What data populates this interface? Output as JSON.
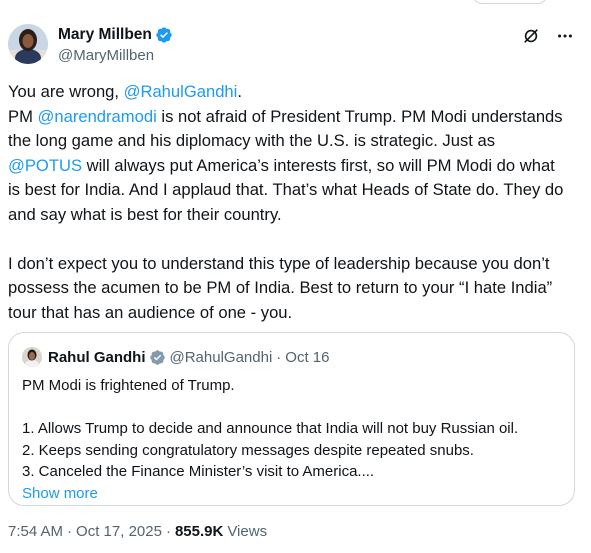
{
  "author": {
    "display_name": "Mary Millben",
    "handle": "@MaryMillben",
    "avatar_icon": "user-avatar"
  },
  "header_icons": [
    "grok-icon",
    "more-icon"
  ],
  "tweet": {
    "line1_prefix": "You are wrong, ",
    "line1_mention": "@RahulGandhi",
    "line1_suffix": ".",
    "p2_a": "PM ",
    "p2_mention1": "@narendramodi",
    "p2_b": " is not afraid of President Trump. PM Modi understands the long game and his diplomacy with the U.S. is strategic. Just as ",
    "p2_mention2": "@POTUS",
    "p2_c": " will always put America’s interests first, so will PM Modi do what is best for India. And I applaud that. That’s what Heads of State do. They do and say what is best for their country.",
    "p3": "I don’t expect you to understand this type of leadership because you don’t possess the acumen to be PM of India. Best to return to your “I hate India” tour that has an audience of one - you."
  },
  "quoted_tweet": {
    "display_name": "Rahul Gandhi",
    "handle": "@RahulGandhi",
    "separator": "·",
    "date": "Oct 16",
    "line1": "PM Modi is frightened of Trump.",
    "item1": "1. Allows Trump to decide and announce that India will not buy Russian oil.",
    "item2": "2. Keeps sending congratulatory messages despite repeated snubs.",
    "item3": "3. Canceled the Finance Minister’s visit to America....",
    "show_more": "Show more"
  },
  "meta": {
    "time": "7:54 AM",
    "sep1": "·",
    "date": "Oct 17, 2025",
    "sep2": "·",
    "views_count": "855.9K",
    "views_label": "Views"
  },
  "colors": {
    "accent": "#1d9bf0",
    "text": "#0f1419",
    "secondary": "#536471",
    "border": "#cfd9de",
    "verified_badge": "#1d9bf0"
  }
}
